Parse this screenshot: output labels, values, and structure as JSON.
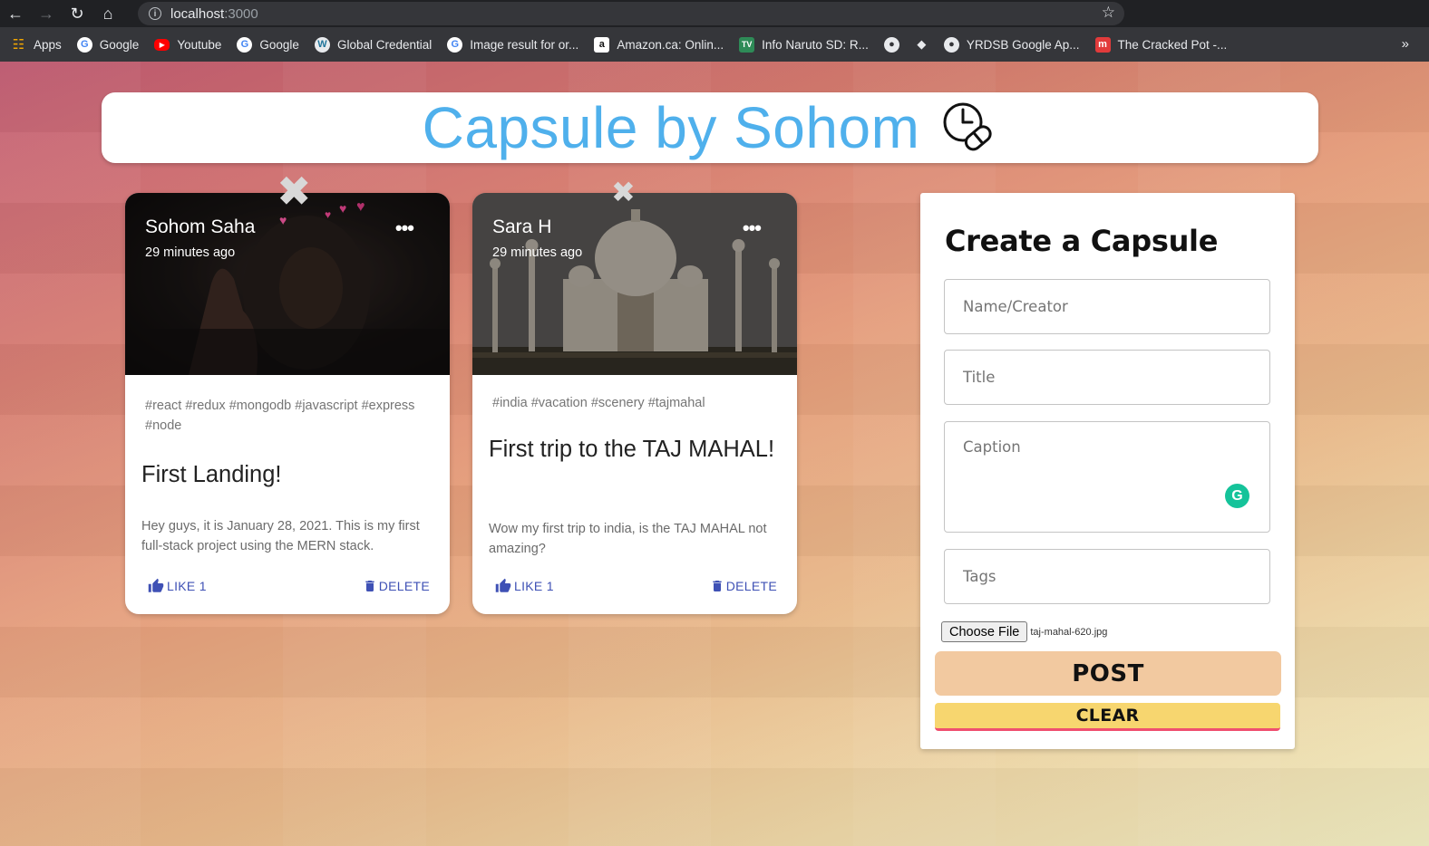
{
  "browser": {
    "url_host": "localhost",
    "url_port": ":3000",
    "bookmarks": [
      {
        "label": "Apps",
        "icon": "apps-grid-icon"
      },
      {
        "label": "Google",
        "icon": "google-icon"
      },
      {
        "label": "Youtube",
        "icon": "youtube-icon"
      },
      {
        "label": "Google",
        "icon": "google-icon"
      },
      {
        "label": "Global Credential",
        "icon": "wordpress-icon"
      },
      {
        "label": "Image result for or...",
        "icon": "google-icon"
      },
      {
        "label": "Amazon.ca: Onlin...",
        "icon": "amazon-icon"
      },
      {
        "label": "Info Naruto SD: R...",
        "icon": "tv-icon"
      },
      {
        "label": "",
        "icon": "globe-icon"
      },
      {
        "label": "",
        "icon": "diamond-icon"
      },
      {
        "label": "YRDSB Google Ap...",
        "icon": "globe-icon"
      },
      {
        "label": "The Cracked Pot -...",
        "icon": "m-icon"
      }
    ],
    "more": "»"
  },
  "app": {
    "title": "Capsule by Sohom",
    "accent": "#4fb0ec"
  },
  "posts": [
    {
      "creator": "Sohom Saha",
      "time": "29 minutes ago",
      "tags": "#react #redux #mongodb #javascript #express #node",
      "title": "First Landing!",
      "message": "Hey guys, it is January 28, 2021. This is my first full-stack project using the MERN stack.",
      "like_label": "LIKE 1",
      "delete_label": "DELETE"
    },
    {
      "creator": "Sara H",
      "time": "29 minutes ago",
      "tags": "#india #vacation #scenery #tajmahal",
      "title": "First trip to the TAJ MAHAL!",
      "message": "Wow my first trip to india, is the TAJ MAHAL not amazing?",
      "like_label": "LIKE 1",
      "delete_label": "DELETE"
    }
  ],
  "form": {
    "heading": "Create a Capsule",
    "name_placeholder": "Name/Creator",
    "title_placeholder": "Title",
    "caption_placeholder": "Caption",
    "tags_placeholder": "Tags",
    "choose_file_label": "Choose File",
    "file_name": "taj-mahal-620.jpg",
    "post_label": "POST",
    "clear_label": "CLEAR",
    "post_color": "#f2c9a0",
    "clear_color": "#f7d66f"
  }
}
